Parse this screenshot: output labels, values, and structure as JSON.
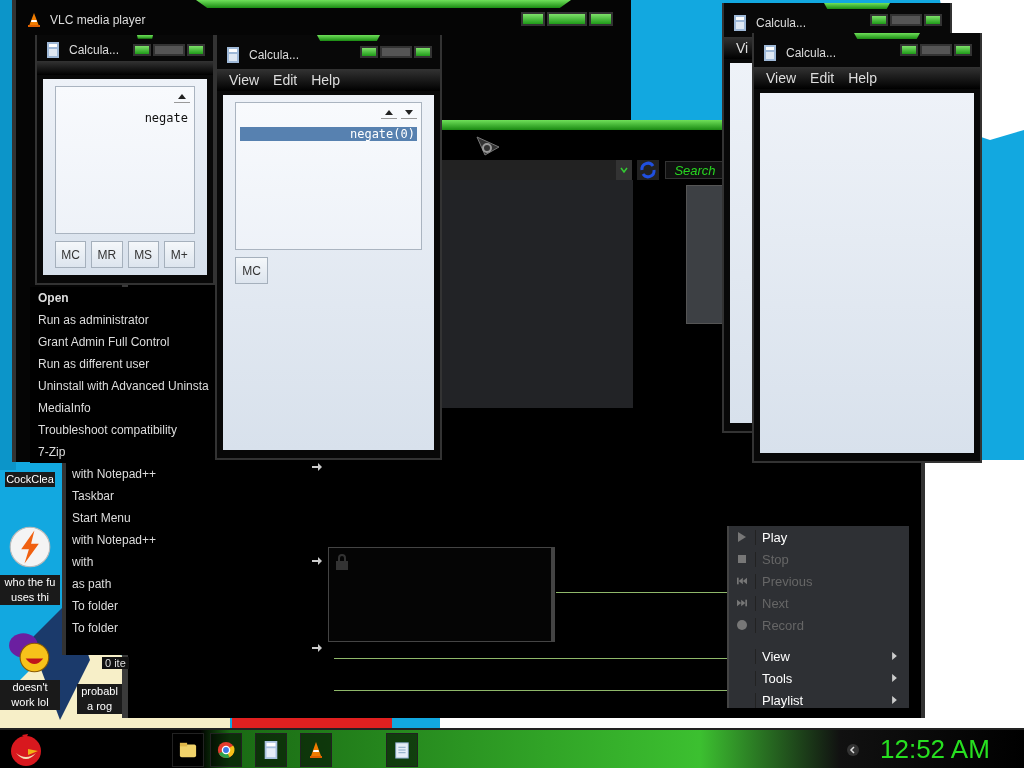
{
  "vlc_window": {
    "title": "VLC media player"
  },
  "desktop_icons": [
    {
      "label": "CockClea"
    },
    {
      "label": "who the fu uses thi"
    },
    {
      "label": "doesn't work lol"
    },
    {
      "label": "probabl a rog"
    }
  ],
  "browser": {
    "search_button": "Search"
  },
  "calculators": [
    {
      "title": "Calcula...",
      "history": [
        {
          "text": "negate",
          "selected": false
        }
      ],
      "memory_buttons": [
        "MC",
        "MR",
        "MS",
        "M+"
      ]
    },
    {
      "title": "Calcula...",
      "menu": [
        "View",
        "Edit",
        "Help"
      ],
      "history": [
        {
          "text": "negate(0)",
          "selected": true
        }
      ],
      "memory_buttons": [
        "MC"
      ]
    },
    {
      "title": "Calcula...",
      "menu": [
        "Vi"
      ]
    },
    {
      "title": "Calcula...",
      "menu": [
        "View",
        "Edit",
        "Help"
      ]
    }
  ],
  "context_menu": [
    {
      "label": "Open",
      "default": true
    },
    {
      "label": "Run as administrator",
      "default": false
    },
    {
      "label": "Grant Admin Full Control",
      "default": false
    },
    {
      "label": "Run as different user",
      "default": false
    },
    {
      "label": "Uninstall with Advanced Uninsta",
      "default": false
    },
    {
      "label": "MediaInfo",
      "default": false
    },
    {
      "label": "Troubleshoot compatibility",
      "default": false
    },
    {
      "label": "7-Zip",
      "default": false
    }
  ],
  "context_submenu": [
    "with Notepad++",
    "Taskbar",
    "Start Menu",
    "with Notepad++",
    "with",
    "as path",
    "To folder",
    "To folder"
  ],
  "folder_status": "0 ite",
  "player_menu": [
    {
      "label": "Play",
      "disabled": false,
      "submenu": false
    },
    {
      "label": "Stop",
      "disabled": true,
      "submenu": false
    },
    {
      "label": "Previous",
      "disabled": true,
      "submenu": false
    },
    {
      "label": "Next",
      "disabled": true,
      "submenu": false
    },
    {
      "label": "Record",
      "disabled": true,
      "submenu": false
    },
    {
      "label": "View",
      "disabled": false,
      "submenu": true
    },
    {
      "label": "Tools",
      "disabled": false,
      "submenu": true
    },
    {
      "label": "Playlist",
      "disabled": false,
      "submenu": true
    }
  ],
  "taskbar": {
    "apps": [
      {
        "kind": "folder"
      },
      {
        "kind": "browser"
      },
      {
        "kind": "calculator"
      },
      {
        "kind": "cone"
      },
      {
        "kind": "notepad"
      }
    ],
    "clock": "12:52 AM"
  }
}
